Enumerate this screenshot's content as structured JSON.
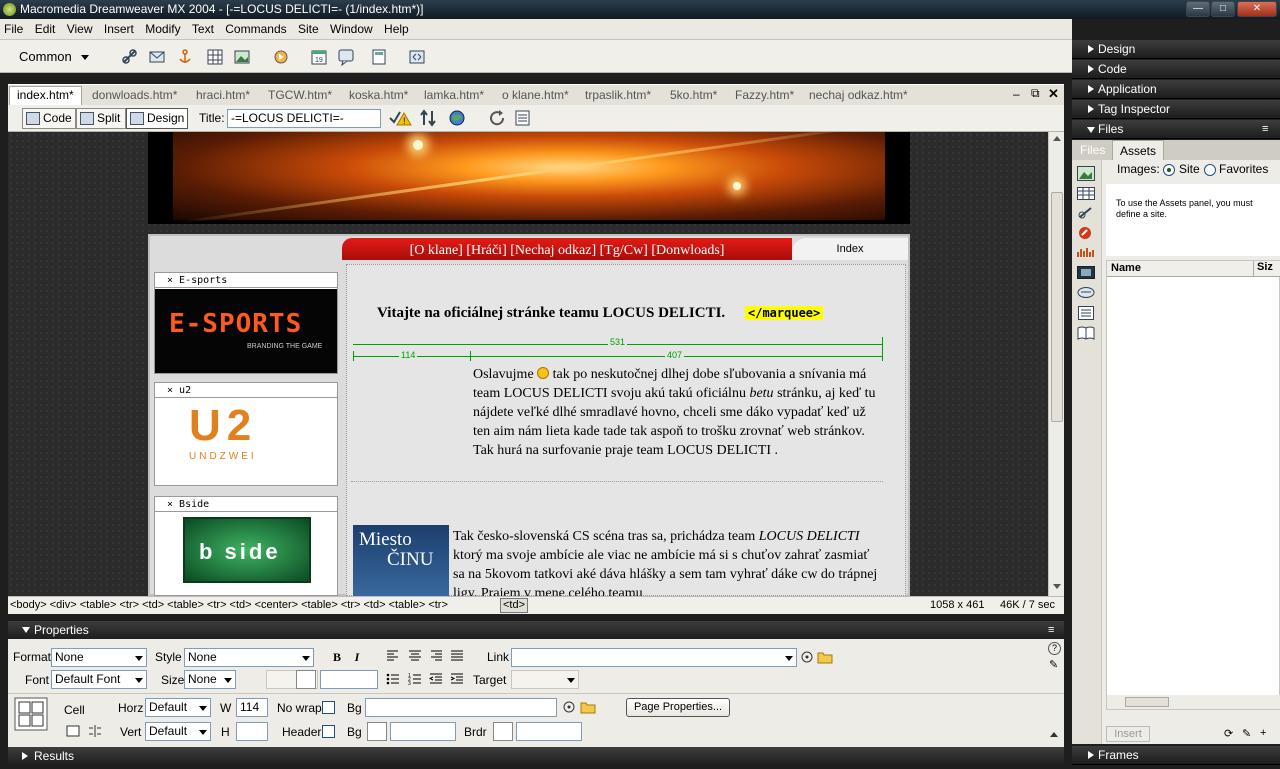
{
  "window": {
    "title": "Macromedia Dreamweaver MX 2004 - [-=LOCUS DELICTI=- (1/index.htm*)]",
    "controls": [
      "minimize",
      "maximize",
      "close"
    ]
  },
  "menu": [
    "File",
    "Edit",
    "View",
    "Insert",
    "Modify",
    "Text",
    "Commands",
    "Site",
    "Window",
    "Help"
  ],
  "insert_bar": {
    "category": "Common",
    "icons": [
      "hyperlink-icon",
      "email-link-icon",
      "named-anchor-icon",
      "table-icon",
      "image-icon",
      "media-icon",
      "date-icon",
      "comment-icon",
      "templates-icon",
      "tag-chooser-icon"
    ]
  },
  "doc_tabs": [
    "index.htm*",
    "donwloads.htm*",
    "hraci.htm*",
    "TGCW.htm*",
    "koska.htm*",
    "lamka.htm*",
    "o klane.htm*",
    "trpaslik.htm*",
    "5ko.htm*",
    "Fazzy.htm*",
    "nechaj odkaz.htm*"
  ],
  "doc_toolbar": {
    "code": "Code",
    "split": "Split",
    "design": "Design",
    "title_label": "Title:",
    "title_value": "-=LOCUS DELICTI=-"
  },
  "page": {
    "nav": "[O klane] [Hráči] [Nechaj odkaz] [Tg/Cw] [Donwloads]",
    "index_tab": "Index",
    "sidebar": [
      {
        "title": "E-sports",
        "logo": "E-SPORTS",
        "tagline": "BRANDING THE GAME"
      },
      {
        "title": "u2",
        "logo": "U2",
        "tagline": "UNDZWEI"
      },
      {
        "title": "Bside",
        "logo": "b side"
      }
    ],
    "welcome": "Vitajte na oficiálnej stránke teamu LOCUS DELICTI.",
    "marquee_tag": "</marquee>",
    "width_531": "531",
    "width_114": "114",
    "width_407": "407",
    "para1_a": "Oslavujme",
    "para1_b": "tak po neskutočnej dlhej dobe sľubovania a snívania má team LOCUS DELICTI svoju akú takú oficiálnu",
    "para1_em": "betu",
    "para1_c": "stránku, aj keď tu nájdete veľké dlhé smradlavé hovno, chceli sme dáko vypadať keď už ten aim nám lieta kade tade tak aspoň to trošku zrovnať web stránkov. Tak hurá na surfovanie praje team LOCUS DELICTI .",
    "image2_line1": "Miesto",
    "image2_line2": "ČINU",
    "para2_a": "Tak česko-slovenská CS scéna tras sa, prichádza team",
    "para2_em": "LOCUS DELICTI",
    "para2_b": "ktorý ma svoje ambície ale viac ne ambície má si s chuťov zahrať zasmiať sa na 5kovom tatkovi aké dáva hlášky a sem tam vyhrať dáke cw do trápnej ligy. Prajem v mene celého teamu"
  },
  "status": {
    "tags": "<body> <div> <table> <tr> <td> <table> <tr> <td> <center> <table> <tr> <td> <table> <tr>",
    "current_tag": "<td>",
    "size": "1058 x 461",
    "weight": "46K / 7 sec"
  },
  "properties": {
    "header": "Properties",
    "format_label": "Format",
    "format_value": "None",
    "style_label": "Style",
    "style_value": "None",
    "bold": "B",
    "italic": "I",
    "link_label": "Link",
    "font_label": "Font",
    "font_value": "Default Font",
    "size_label": "Size",
    "size_value": "None",
    "target_label": "Target",
    "cell_label": "Cell",
    "horz_label": "Horz",
    "horz_value": "Default",
    "w_label": "W",
    "w_value": "114",
    "nowrap_label": "No wrap",
    "bg_label": "Bg",
    "page_properties": "Page Properties...",
    "vert_label": "Vert",
    "vert_value": "Default",
    "h_label": "H",
    "header_label": "Header",
    "bg2_label": "Bg",
    "brdr_label": "Brdr"
  },
  "results_header": "Results",
  "right_panels": {
    "design": "Design",
    "code": "Code",
    "application": "Application",
    "tag_inspector": "Tag Inspector",
    "files": "Files",
    "tab_files": "Files",
    "tab_assets": "Assets",
    "images_label": "Images:",
    "site_option": "Site",
    "favorites_option": "Favorites",
    "assets_message": "To use the Assets panel, you must define a site.",
    "col_name": "Name",
    "col_size": "Siz",
    "insert_btn": "Insert",
    "frames": "Frames"
  },
  "colors": {
    "nav_red": "#c8100e",
    "highlight_yellow": "#ffff00",
    "guide_green": "#00a000"
  }
}
